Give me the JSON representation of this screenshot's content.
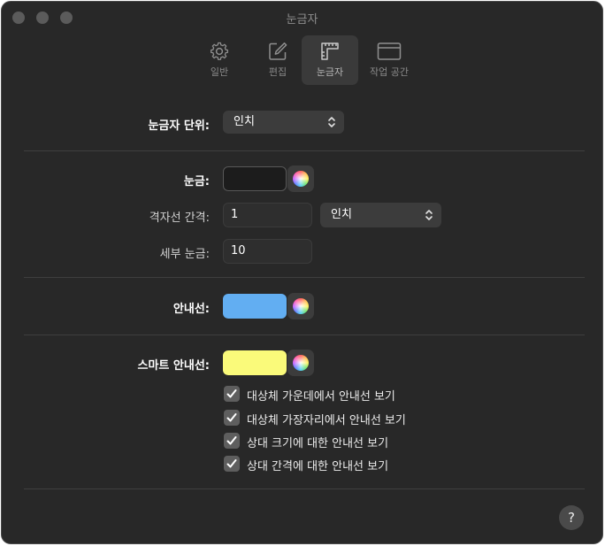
{
  "window": {
    "title": "눈금자"
  },
  "tabs": [
    {
      "label": "일반",
      "icon": "gear-icon"
    },
    {
      "label": "편집",
      "icon": "edit-icon"
    },
    {
      "label": "눈금자",
      "icon": "ruler-icon",
      "selected": true
    },
    {
      "label": "작업 공간",
      "icon": "window-icon"
    }
  ],
  "ruler_units": {
    "label": "눈금자 단위:",
    "value": "인치"
  },
  "grid": {
    "label": "눈금:",
    "color": "#1c1c1c",
    "spacing_label": "격자선 간격:",
    "spacing_value": "1",
    "spacing_unit": "인치",
    "subdivisions_label": "세부 눈금:",
    "subdivisions_value": "10"
  },
  "guides": {
    "label": "안내선:",
    "color": "#62aef2"
  },
  "smart_guides": {
    "label": "스마트 안내선:",
    "color": "#fafa7a",
    "options": [
      {
        "label": "대상체 가운데에서 안내선 보기",
        "checked": true
      },
      {
        "label": "대상체 가장자리에서 안내선 보기",
        "checked": true
      },
      {
        "label": "상대 크기에 대한 안내선 보기",
        "checked": true
      },
      {
        "label": "상대 간격에 대한 안내선 보기",
        "checked": true
      }
    ]
  },
  "help": {
    "label": "?"
  }
}
